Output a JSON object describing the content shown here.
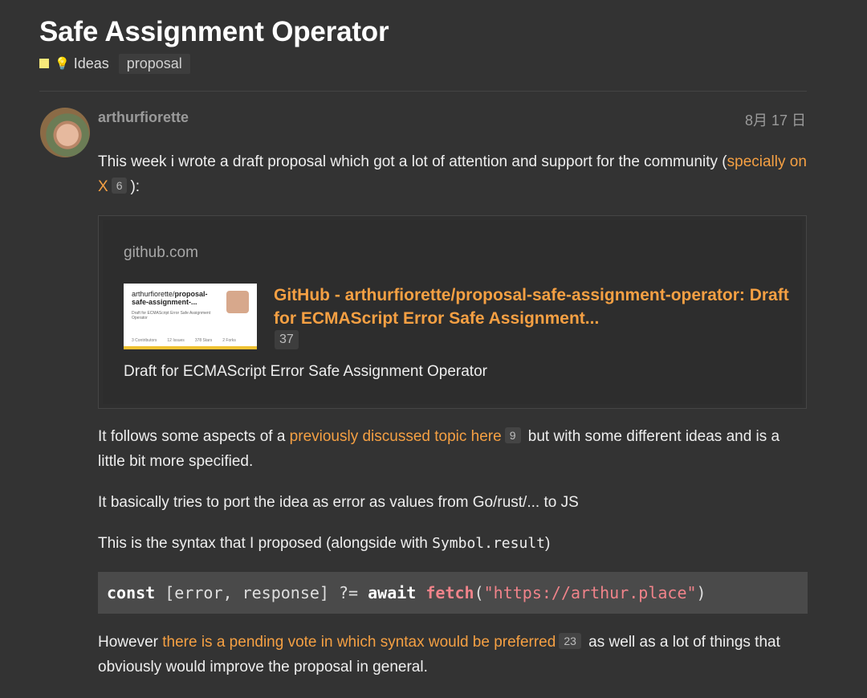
{
  "topic": {
    "title": "Safe Assignment Operator",
    "category": {
      "icon": "lightbulb-icon",
      "label": "Ideas",
      "color": "#f7e87a"
    },
    "tag": "proposal"
  },
  "post": {
    "username": "arthurfiorette",
    "date": "8月 17 日",
    "p1": {
      "text": "This week i wrote a draft proposal which got a lot of attention and support for the community (",
      "link": "specially on X",
      "count": "6",
      "after": "):"
    },
    "onebox": {
      "source": "github.com",
      "thumb_title_owner": "arthurfiorette/",
      "thumb_title_repo": "proposal-safe-assignment-...",
      "thumb_desc": "Draft for ECMAScript Error Safe Assignment Operator",
      "thumb_stats": [
        "3 Contributors",
        "12 Issues",
        "378 Stars",
        "2 Forks"
      ],
      "title": "GitHub - arthurfiorette/proposal-safe-assignment-operator: Draft for ECMAScript Error Safe Assignment...",
      "count": "37",
      "description": "Draft for ECMAScript Error Safe Assignment Operator"
    },
    "p2": {
      "before": "It follows some aspects of a ",
      "link": "previously discussed topic here",
      "count": "9",
      "after": " but with some different ideas and is a little bit more specified."
    },
    "p3": "It basically tries to port the idea as error as values from Go/rust/... to JS",
    "p4": {
      "before": "This is the syntax that I proposed (alongside with ",
      "code": "Symbol.result",
      "after": ")"
    },
    "code": {
      "kw1": "const",
      "mid": " [error, response] ?= ",
      "kw2": "await",
      "fn": " fetch",
      "open": "(",
      "str": "\"https://arthur.place\"",
      "close": ")"
    },
    "p5": {
      "before": "However ",
      "link": "there is a pending vote in which syntax would be preferred",
      "count": "23",
      "after": " as well as a lot of things that obviously would improve the proposal in general."
    }
  },
  "colors": {
    "background": "#333333",
    "link": "#f5a043",
    "code_bg": "#4a4a4a"
  }
}
